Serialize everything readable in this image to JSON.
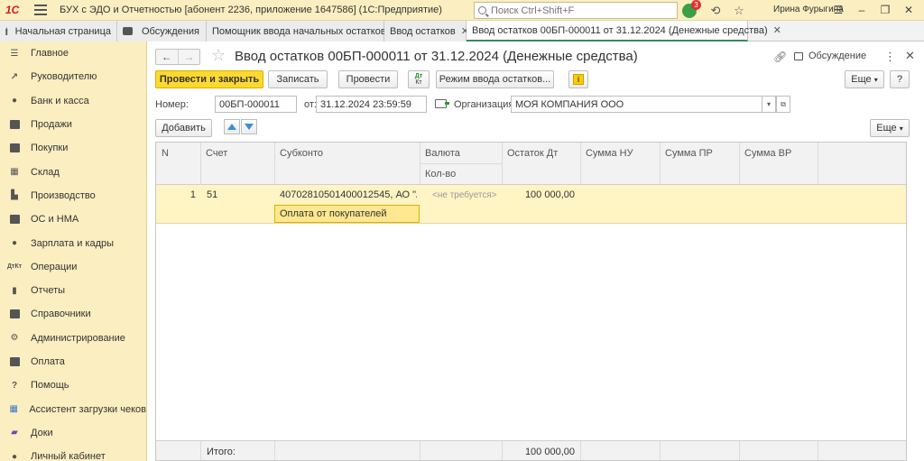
{
  "titlebar": {
    "logo": "1С",
    "title": "БУХ с ЭДО и Отчетностью [абонент 2236, приложение 1647586]  (1С:Предприятие)",
    "search_placeholder": "Поиск Ctrl+Shift+F",
    "notification_count": "3",
    "user": "Ирина Фурыгина"
  },
  "tabs": [
    {
      "label": "Начальная страница"
    },
    {
      "label": "Обсуждения"
    },
    {
      "label": "Помощник ввода начальных остатков"
    },
    {
      "label": "Ввод остатков"
    },
    {
      "label": "Ввод остатков 00БП-000011 от 31.12.2024 (Денежные средства)"
    }
  ],
  "sidebar": {
    "items": [
      {
        "label": "Главное",
        "icon": "menu-icon"
      },
      {
        "label": "Руководителю",
        "icon": "chart-icon"
      },
      {
        "label": "Банк и касса",
        "icon": "coin-icon"
      },
      {
        "label": "Продажи",
        "icon": "cart-icon"
      },
      {
        "label": "Покупки",
        "icon": "basket-icon"
      },
      {
        "label": "Склад",
        "icon": "warehouse-icon"
      },
      {
        "label": "Производство",
        "icon": "factory-icon"
      },
      {
        "label": "ОС и НМА",
        "icon": "truck-icon"
      },
      {
        "label": "Зарплата и кадры",
        "icon": "person-icon"
      },
      {
        "label": "Операции",
        "icon": "dt-kt-icon"
      },
      {
        "label": "Отчеты",
        "icon": "bar-chart-icon"
      },
      {
        "label": "Справочники",
        "icon": "book-icon"
      },
      {
        "label": "Администрирование",
        "icon": "gear-icon"
      },
      {
        "label": "Оплата",
        "icon": "wallet-icon"
      },
      {
        "label": "Помощь",
        "icon": "question-icon"
      },
      {
        "label": "Ассистент загрузки чеков",
        "icon": "grid-icon"
      },
      {
        "label": "Доки",
        "icon": "docs-icon"
      },
      {
        "label": "Личный кабинет",
        "icon": "user-icon"
      }
    ]
  },
  "document": {
    "title": "Ввод остатков 00БП-000011 от 31.12.2024 (Денежные средства)",
    "discussion_label": "Обсуждение"
  },
  "toolbar": {
    "post_close": "Провести и закрыть",
    "save": "Записать",
    "post": "Провести",
    "dt": "Дт",
    "kt": "Кт",
    "mode": "Режим ввода остатков...",
    "info": "i",
    "more": "Еще",
    "help": "?"
  },
  "form": {
    "number_label": "Номер:",
    "number_value": "00БП-000011",
    "date_label": "от:",
    "date_value": "31.12.2024 23:59:59",
    "org_label": "Организация:",
    "org_value": "МОЯ КОМПАНИЯ ООО"
  },
  "table_toolbar": {
    "add": "Добавить",
    "more": "Еще"
  },
  "table": {
    "headers": {
      "n": "N",
      "account": "Счет",
      "subconto": "Субконто",
      "currency": "Валюта",
      "qty": "Кол-во",
      "balance_dt": "Остаток Дт",
      "sum_nu": "Сумма НУ",
      "sum_pr": "Сумма ПР",
      "sum_vr": "Сумма ВР"
    },
    "rows": [
      {
        "n": "1",
        "account": "51",
        "subconto1": "40702810501400012545, АО \"А...",
        "subconto2": "Оплата от покупателей",
        "currency": "<не требуется>",
        "balance_dt": "100 000,00"
      }
    ],
    "footer": {
      "label": "Итого:",
      "balance_dt": "100 000,00"
    }
  }
}
